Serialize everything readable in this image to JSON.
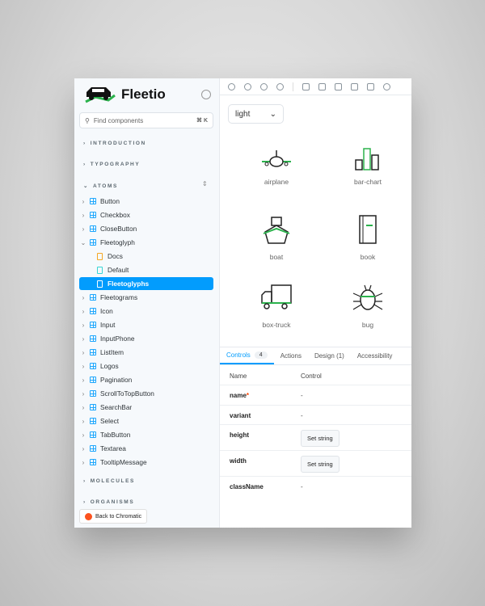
{
  "brand": {
    "name": "Fleetio"
  },
  "search": {
    "placeholder": "Find components",
    "shortcut": "⌘ K"
  },
  "sections": {
    "introduction": "INTRODUCTION",
    "typography": "TYPOGRAPHY",
    "atoms": "ATOMS",
    "molecules": "MOLECULES",
    "organisms": "ORGANISMS"
  },
  "atoms": [
    "Button",
    "Checkbox",
    "CloseButton",
    "Fleetoglyph",
    "Fleetograms",
    "Icon",
    "Input",
    "InputPhone",
    "ListItem",
    "Logos",
    "Pagination",
    "ScrollToTopButton",
    "SearchBar",
    "Select",
    "TabButton",
    "Textarea",
    "TooltipMessage"
  ],
  "fleetoglyph_children": {
    "docs": "Docs",
    "default": "Default",
    "selected": "Fleetoglyphs"
  },
  "back_button": "Back to Chromatic",
  "theme_select": {
    "value": "light"
  },
  "glyphs": [
    "airplane",
    "bar-chart",
    "boat",
    "book",
    "box-truck",
    "bug"
  ],
  "tabs": {
    "controls": "Controls",
    "controls_count": "4",
    "actions": "Actions",
    "design": "Design (1)",
    "accessibility": "Accessibility"
  },
  "table": {
    "headers": {
      "name": "Name",
      "control": "Control"
    },
    "rows": [
      {
        "name": "name",
        "required": "*",
        "control": "-"
      },
      {
        "name": "variant",
        "control": "-"
      },
      {
        "name": "height",
        "control": "Set string"
      },
      {
        "name": "width",
        "control": "Set string"
      },
      {
        "name": "className",
        "control": "-"
      }
    ]
  },
  "colors": {
    "accent": "#029cfd",
    "glyph_green": "#2bb24c"
  }
}
